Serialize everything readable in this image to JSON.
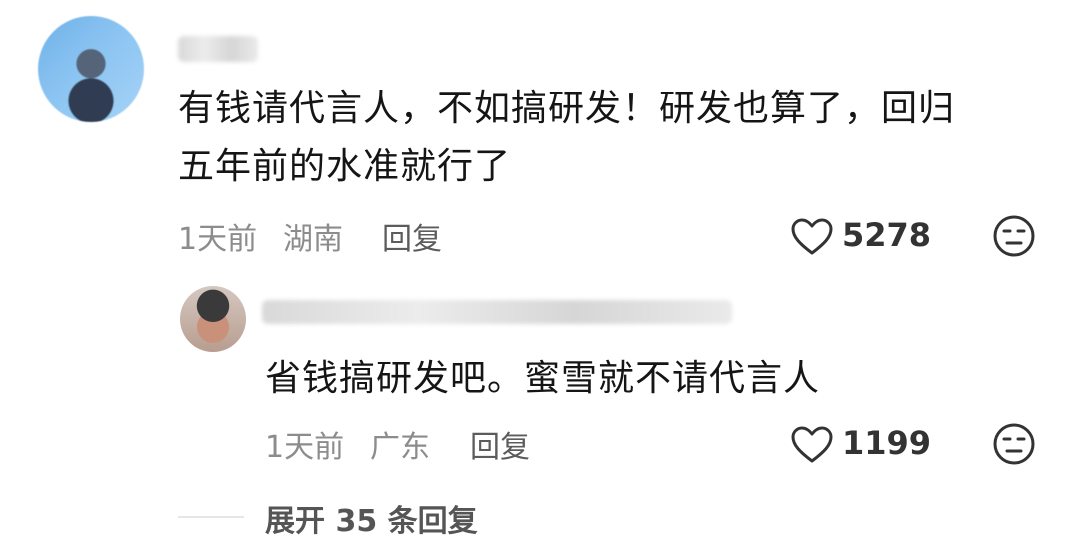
{
  "comment": {
    "text_line1": "有钱请代言人，不如搞研发！研发也算了，回归",
    "text_line2": "五年前的水准就行了",
    "time": "1天前",
    "location": "湖南",
    "reply_label": "回复",
    "likes": "5278"
  },
  "reply": {
    "text": "省钱搞研发吧。蜜雪就不请代言人",
    "time": "1天前",
    "location": "广东",
    "reply_label": "回复",
    "likes": "1199"
  },
  "expand": {
    "label": "展开 35 条回复"
  },
  "icons": {
    "like": "heart-outline-icon",
    "dislike": "neutral-face-icon"
  }
}
